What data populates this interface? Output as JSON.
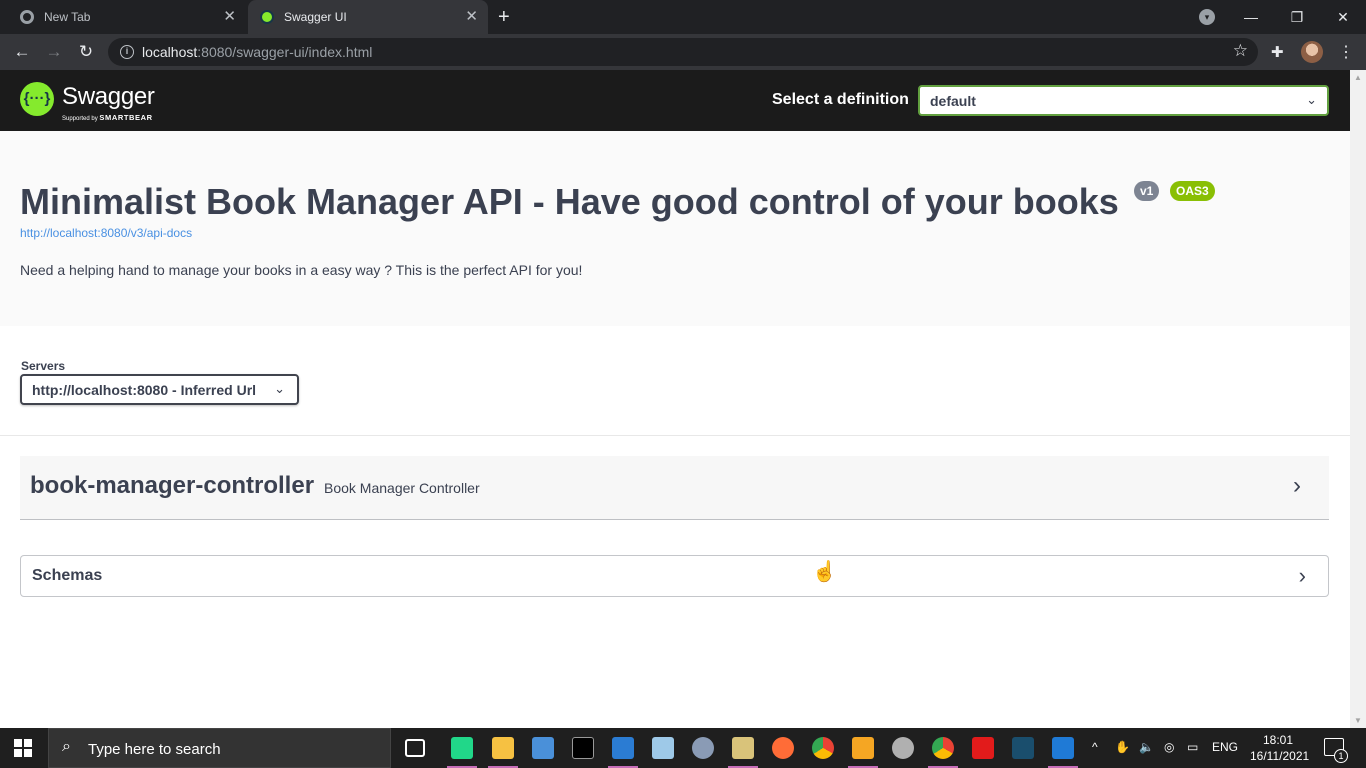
{
  "browser": {
    "tabs": [
      {
        "title": "New Tab",
        "active": false
      },
      {
        "title": "Swagger UI",
        "active": true
      }
    ],
    "address": {
      "host": "localhost",
      "path": ":8080/swagger-ui/index.html"
    }
  },
  "swagger": {
    "brand": "Swagger",
    "brand_sub_prefix": "Supported by",
    "brand_sub_company": "SMARTBEAR",
    "definition_label": "Select a definition",
    "definition_value": "default",
    "api_title": "Minimalist Book Manager API - Have good control of your books",
    "version_badge": "v1",
    "oas_badge": "OAS3",
    "docs_link": "http://localhost:8080/v3/api-docs",
    "description": "Need a helping hand to manage your books in a easy way ? This is the perfect API for you!",
    "servers_label": "Servers",
    "servers_value": "http://localhost:8080 - Inferred Url",
    "tag_name": "book-manager-controller",
    "tag_description": "Book Manager Controller",
    "schemas_label": "Schemas",
    "accent_color": "#85ea2d"
  },
  "taskbar": {
    "search_placeholder": "Type here to search",
    "language": "ENG",
    "time": "18:01",
    "date": "16/11/2021",
    "notification_count": "1"
  }
}
